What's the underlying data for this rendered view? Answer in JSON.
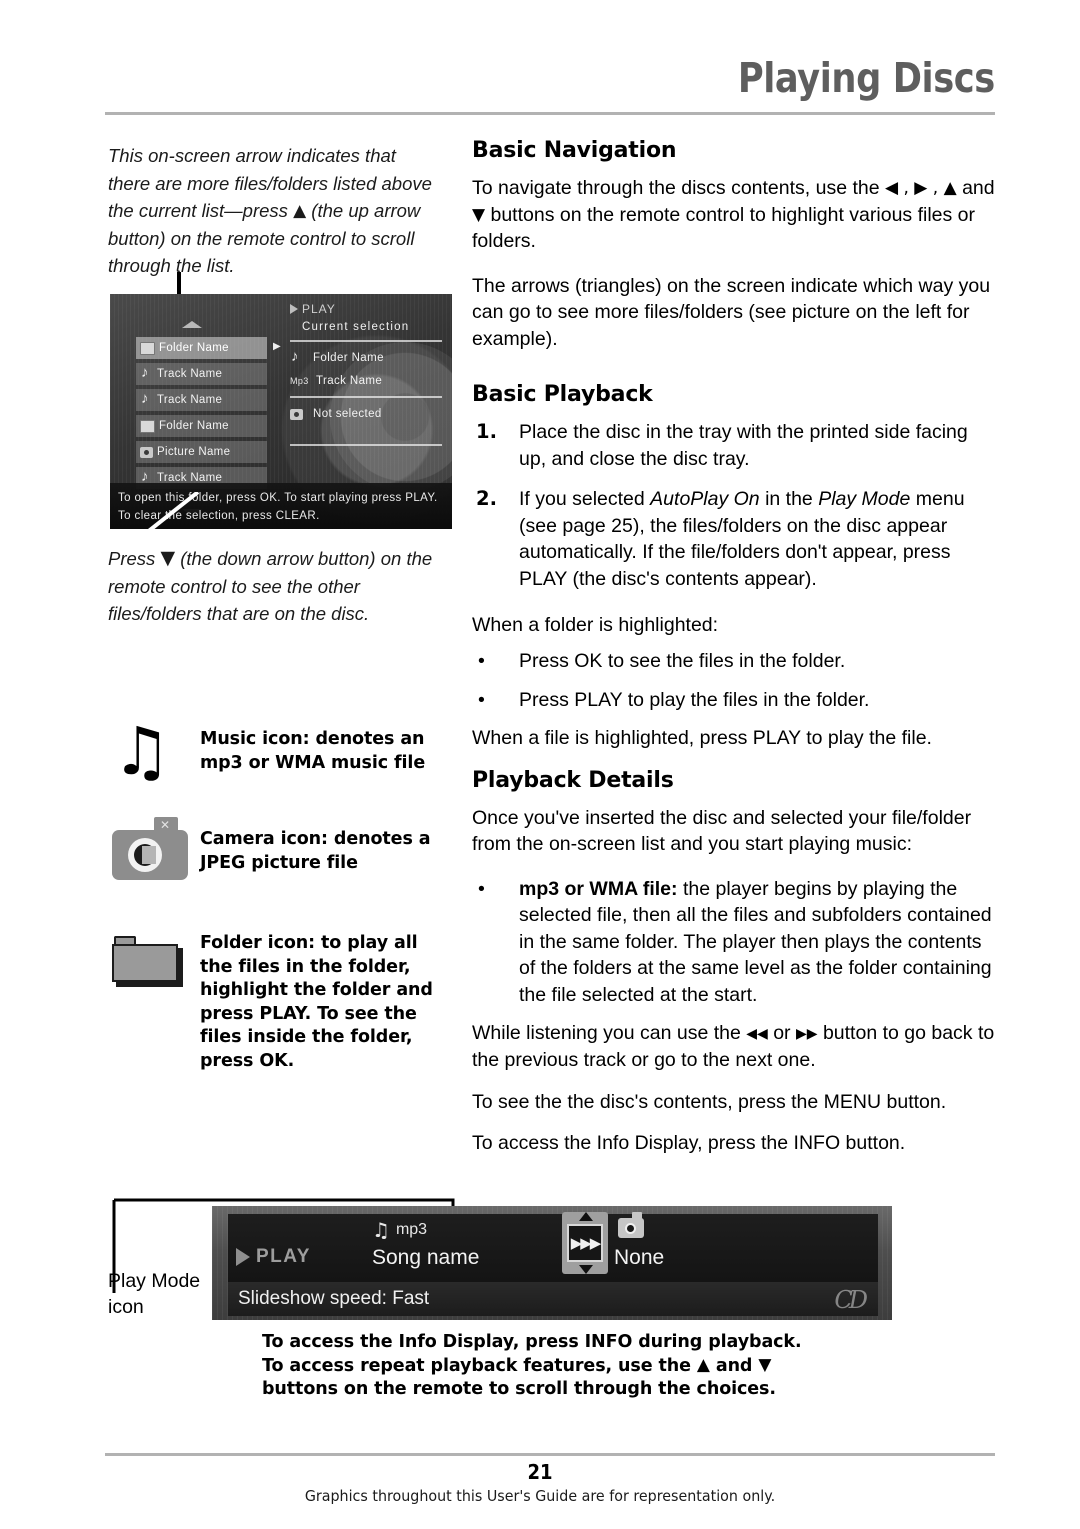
{
  "header": {
    "title": "Playing Discs"
  },
  "left": {
    "note_up": {
      "text": "This on-screen arrow indicates that there are more files/folders listed above the current list—press ",
      "arrow": "▲",
      "text2": " (the up arrow button) on the remote control to scroll through the list."
    },
    "note_down": {
      "text": "Press ",
      "arrow": "▼",
      "text2": " (the down arrow button) on the remote control to see the other files/folders that are on the disc."
    }
  },
  "osd_list": {
    "up_arrow_icon": "triangle-up-icon",
    "down_arrow_icon": "triangle-down-icon",
    "left_nav_icon": "triangle-left-icon",
    "right_nav_icon": "triangle-right-icon",
    "rows": [
      {
        "icon": "folder-icon",
        "label": "Folder Name",
        "selected": true
      },
      {
        "icon": "music-note-icon",
        "label": "Track Name",
        "selected": false
      },
      {
        "icon": "music-note-icon",
        "label": "Track Name",
        "selected": false
      },
      {
        "icon": "folder-icon",
        "label": "Folder Name",
        "selected": false
      },
      {
        "icon": "camera-icon",
        "label": "Picture Name",
        "selected": false
      },
      {
        "icon": "music-note-icon",
        "label": "Track Name",
        "selected": false
      }
    ],
    "play_label": "PLAY",
    "current_selection": "Current selection",
    "items": [
      {
        "tag": "",
        "icon": "music-note-icon",
        "label": "Folder Name"
      },
      {
        "tag": "Mp3",
        "icon": "",
        "label": "Track Name"
      },
      {
        "tag": "",
        "icon": "camera-icon",
        "label": "Not selected"
      }
    ],
    "hint_line_1": "To open this folder, press OK. To start playing press PLAY.",
    "hint_line_2": "To clear the selection, press CLEAR."
  },
  "legend": [
    {
      "icon": "music-note-icon",
      "text": "Music icon: denotes an mp3 or WMA music file"
    },
    {
      "icon": "camera-icon",
      "text": "Camera icon: denotes a JPEG picture file"
    },
    {
      "icon": "folder-icon",
      "text": "Folder icon: to play all the files in the folder, highlight the folder and press PLAY. To see the files inside the folder, press OK."
    }
  ],
  "right": {
    "basic_navigation": {
      "heading": "Basic Navigation",
      "p1_a": "To navigate through the discs contents, use the ",
      "p1_arrows": "◀ , ▶ , ▲",
      "p1_b": " and ",
      "p1_arrow_down": "▼",
      "p1_c": " buttons on the remote control to highlight various files or folders.",
      "p2": "The arrows (triangles) on the screen indicate which way you can go to see more files/folders (see picture on the left for example)."
    },
    "basic_playback": {
      "heading": "Basic Playback",
      "step1_num": "1.",
      "step1": "Place the disc in the tray with the printed side facing up, and close the disc tray.",
      "step2_num": "2.",
      "step2_a": "If you selected ",
      "step2_em1": "AutoPlay On",
      "step2_b": " in the ",
      "step2_em2": "Play Mode",
      "step2_c": " menu (see page 25), the files/folders on the disc appear automatically. If the file/folders don't appear, press PLAY (the disc's contents appear).",
      "folder_lead": "When a folder is highlighted:",
      "bullets": [
        "Press OK to see the files in the folder.",
        "Press PLAY to play the files in the folder."
      ],
      "file_line": "When a file is highlighted, press PLAY to play the file."
    },
    "playback_details": {
      "heading": "Playback Details",
      "p1": "Once you've inserted the disc and selected your file/folder from the on-screen list and you start playing music:",
      "bullet_bold": "mp3 or WMA file:",
      "bullet_rest": " the player begins by playing the selected file, then all the files and subfolders contained in the same folder. The player then plays the contents of the folders at the same level as the folder containing the file selected at the start.",
      "p2_a": "While listening you can use the ",
      "p2_prev_icon": "◀◀",
      "p2_b": " or ",
      "p2_next_icon": "▶▶",
      "p2_c": " button to go back to the previous track or go to the next one.",
      "p3": "To see the the disc's contents, press the MENU button.",
      "p4": "To access the Info Display, press the INFO button."
    }
  },
  "bottom": {
    "play_mode_label": "Play Mode\nicon",
    "play_mode_label_line1": "Play Mode",
    "play_mode_label_line2": "icon",
    "osd": {
      "play_label": "PLAY",
      "mp3_tag": "mp3",
      "mp3_icon": "music-note-icon",
      "song_name": "Song name",
      "play_mode_icon": "play-mode-fast-forward-icon",
      "play_mode_glyph": "▶▶▶",
      "camera_icon": "camera-icon",
      "picture_value": "None",
      "slideshow_line": "Slideshow speed: Fast",
      "cd_logo": "cd-logo-icon"
    },
    "caption": "To access the Info Display, press INFO during playback. To access repeat playback features, use the ▲ and ▼ buttons on the remote to scroll through the choices.",
    "caption_a": "To access the Info Display, press INFO during playback. To access repeat playback features, use the ",
    "caption_arrow_up": "▲",
    "caption_b": " and ",
    "caption_arrow_down": "▼",
    "caption_c": " buttons on the remote to scroll through the choices."
  },
  "footer": {
    "page_number": "21",
    "note": "Graphics throughout this User's Guide are for representation only."
  },
  "colors": {
    "title_gray": "#5e5e5e",
    "rule_gray": "#b2b2b2",
    "osd_dark": "#3a3a3a",
    "icon_gray": "#8d8d8d"
  }
}
